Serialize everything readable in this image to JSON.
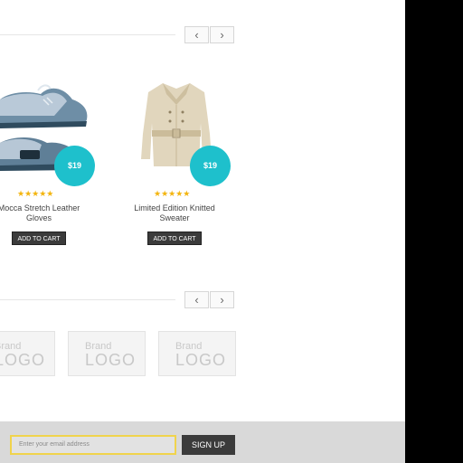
{
  "carousel_top": {
    "prev_icon": "chevron-left",
    "next_icon": "chevron-right",
    "prev_glyph": "‹",
    "next_glyph": "›"
  },
  "products": [
    {
      "price": "$19",
      "rating": 5,
      "stars": "★★★★★",
      "name_line1": "Mocca Stretch Leather",
      "name_line2": "Gloves",
      "cart_label": "ADD TO CART"
    },
    {
      "price": "$19",
      "rating": 5,
      "stars": "★★★★★",
      "name_line1": "Limited Edition Knitted",
      "name_line2": "Sweater",
      "cart_label": "ADD TO CART"
    }
  ],
  "carousel_brands": {
    "prev_glyph": "‹",
    "next_glyph": "›"
  },
  "brands": [
    {
      "top": "Brand",
      "bottom": "LOGO"
    },
    {
      "top": "Brand",
      "bottom": "LOGO"
    },
    {
      "top": "Brand",
      "bottom": "LOGO"
    }
  ],
  "newsletter": {
    "placeholder": "Enter your email address",
    "button_label": "SIGN UP"
  },
  "colors": {
    "accent": "#1ec0cc",
    "star": "#f3b50f",
    "button": "#3b3b3b",
    "input_border": "#f0d34c"
  }
}
